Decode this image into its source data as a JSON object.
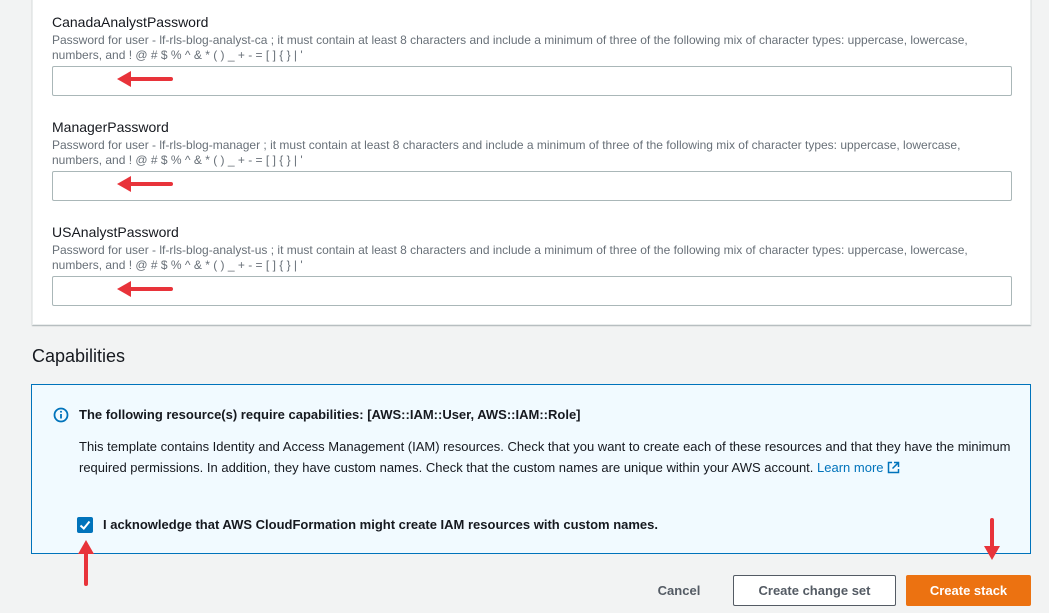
{
  "parameters": [
    {
      "label": "CanadaAnalystPassword",
      "description": "Password for user - lf-rls-blog-analyst-ca ; it must contain at least 8 characters and include a minimum of three of the following mix of character types: uppercase, lowercase, numbers, and ! @ # $ % ^ & * ( ) _ + - = [ ] { } | '",
      "value": ""
    },
    {
      "label": "ManagerPassword",
      "description": "Password for user - lf-rls-blog-manager ; it must contain at least 8 characters and include a minimum of three of the following mix of character types: uppercase, lowercase, numbers, and ! @ # $ % ^ & * ( ) _ + - = [ ] { } | '",
      "value": ""
    },
    {
      "label": "USAnalystPassword",
      "description": "Password for user - lf-rls-blog-analyst-us ; it must contain at least 8 characters and include a minimum of three of the following mix of character types: uppercase, lowercase, numbers, and ! @ # $ % ^ & * ( ) _ + - = [ ] { } | '",
      "value": ""
    }
  ],
  "capabilities": {
    "heading": "Capabilities",
    "alert_title": "The following resource(s) require capabilities: [AWS::IAM::User, AWS::IAM::Role]",
    "alert_text": "This template contains Identity and Access Management (IAM) resources. Check that you want to create each of these resources and that they have the minimum required permissions. In addition, they have custom names. Check that the custom names are unique within your AWS account.",
    "learn_more": "Learn more",
    "acknowledge_label": "I acknowledge that AWS CloudFormation might create IAM resources with custom names.",
    "acknowledge_checked": true
  },
  "actions": {
    "cancel": "Cancel",
    "create_change_set": "Create change set",
    "create_stack": "Create stack"
  },
  "icons": {
    "info": "info-icon",
    "external_link": "external-link-icon",
    "checkmark": "checkmark-icon",
    "annotation_arrow": "red-arrow-icon"
  },
  "colors": {
    "accent": "#0073bb",
    "primary_button": "#ec7211",
    "annotation_arrow": "#e8333a",
    "alert_background": "#f1faff"
  }
}
